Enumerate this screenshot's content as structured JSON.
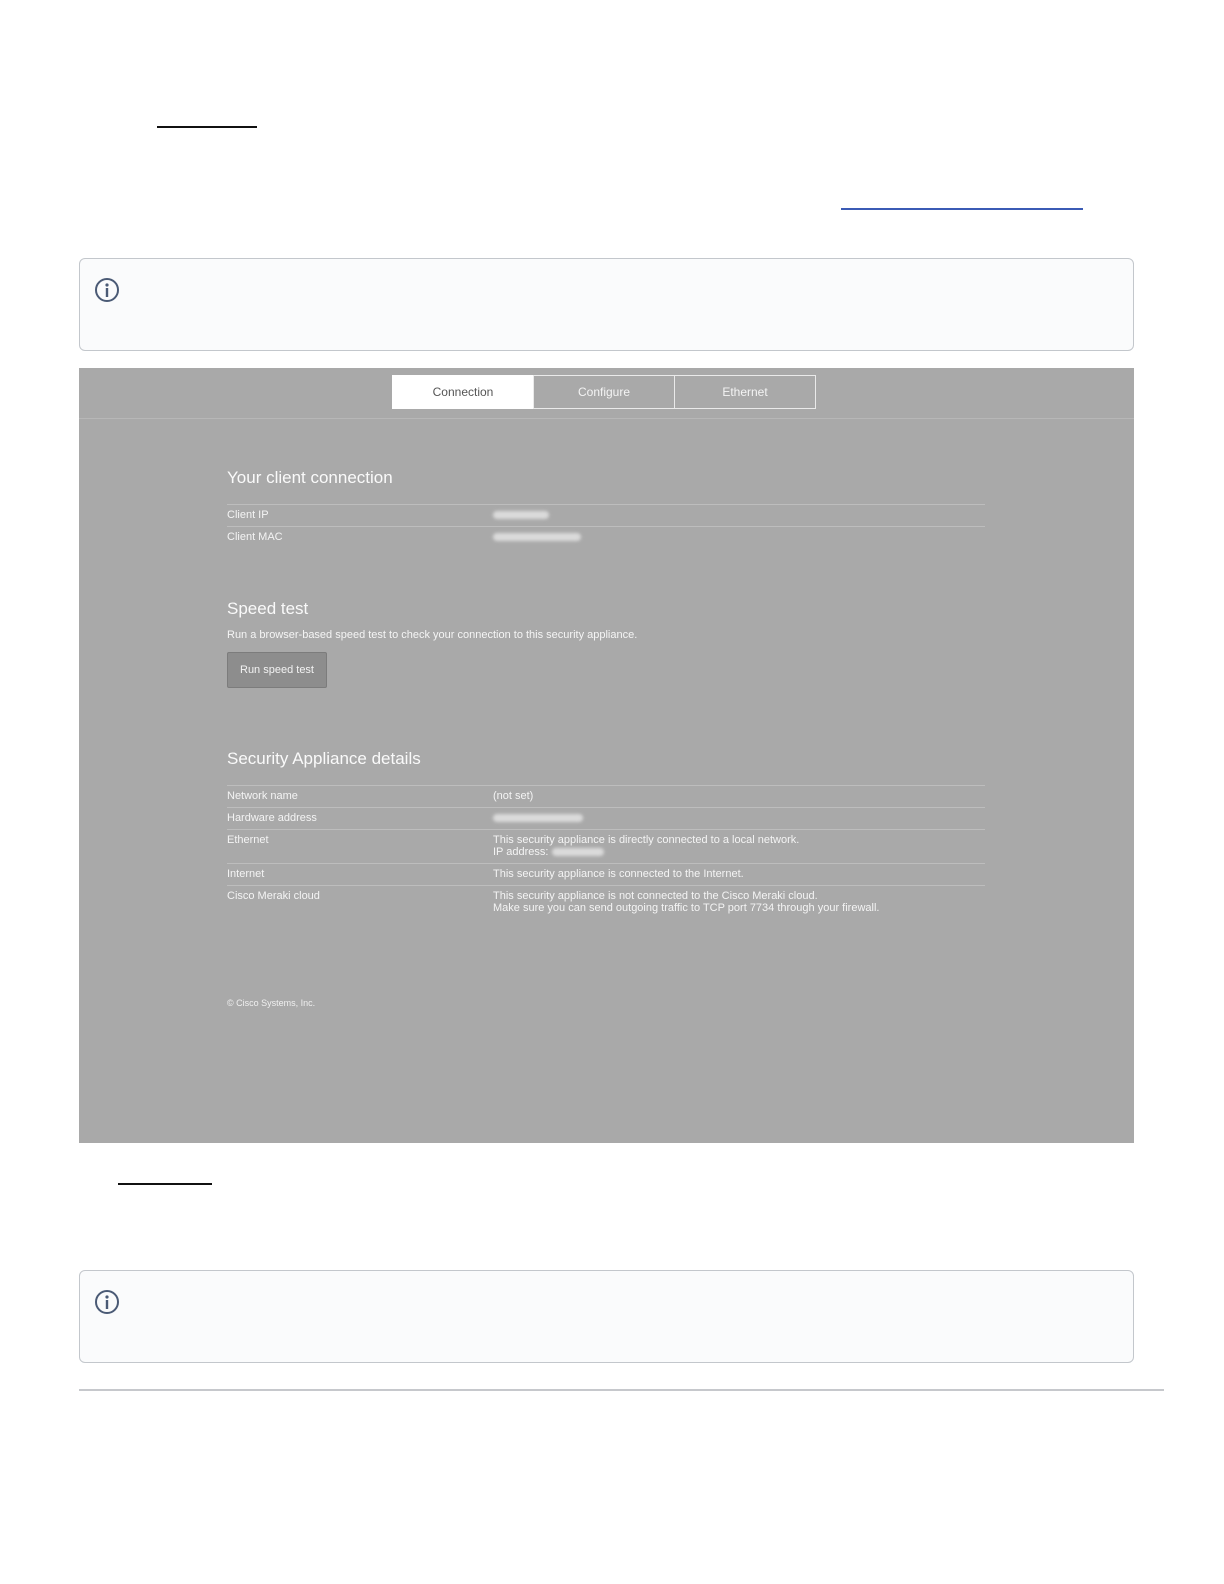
{
  "tabs": [
    {
      "label": "Connection",
      "active": true
    },
    {
      "label": "Configure",
      "active": false
    },
    {
      "label": "Ethernet",
      "active": false
    }
  ],
  "client_connection": {
    "title": "Your client connection",
    "rows": [
      {
        "label": "Client IP"
      },
      {
        "label": "Client MAC"
      }
    ]
  },
  "speed_test": {
    "title": "Speed test",
    "description": "Run a browser-based speed test to check your connection to this security appliance.",
    "button_label": "Run speed test"
  },
  "appliance_details": {
    "title": "Security Appliance details",
    "network_name_label": "Network name",
    "network_name_value": "(not set)",
    "hardware_address_label": "Hardware address",
    "ethernet_label": "Ethernet",
    "ethernet_value_line1": "This security appliance is directly connected to a local network.",
    "ethernet_value_line2": "IP address:",
    "internet_label": "Internet",
    "internet_value": "This security appliance is connected to the Internet.",
    "cloud_label": "Cisco Meraki cloud",
    "cloud_value_line1": "This security appliance is not connected to the Cisco Meraki cloud.",
    "cloud_value_line2": "Make sure you can send outgoing traffic to TCP port 7734 through your firewall."
  },
  "footer": {
    "copyright": "© Cisco Systems, Inc."
  },
  "colors": {
    "screenshot_bg": "#a9a9a9",
    "link_underline": "#3b5bb5",
    "info_border": "#c3c7cc",
    "info_icon": "#4a5a75"
  },
  "icons": {
    "info_box_icon": "info-circle-icon"
  }
}
